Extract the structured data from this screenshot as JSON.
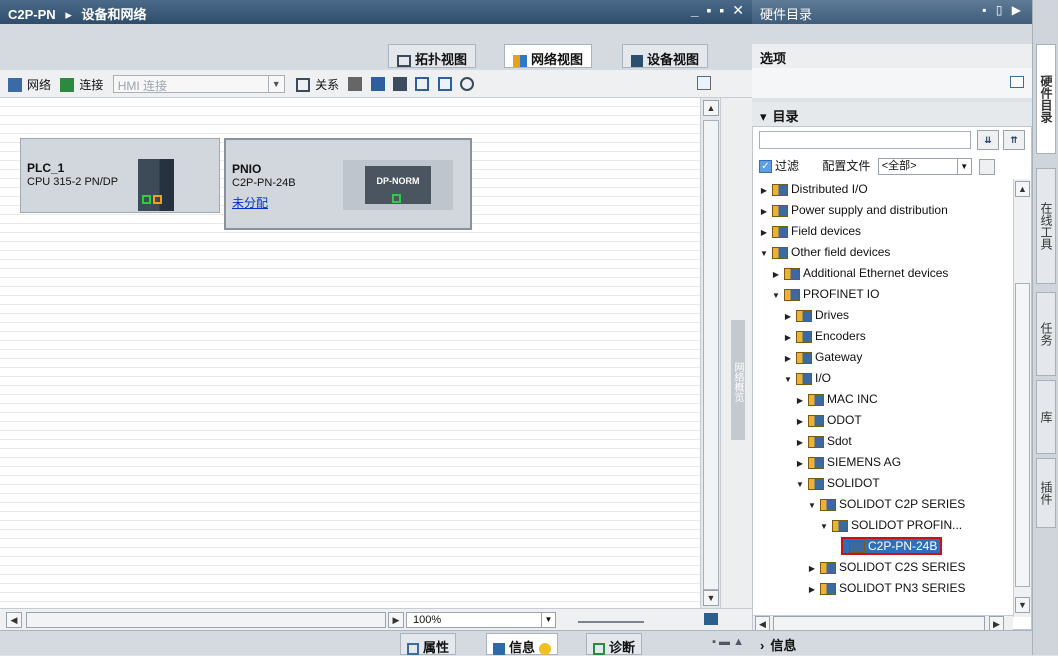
{
  "left_window": {
    "breadcrumb_root": "C2P-PN",
    "breadcrumb_sep": "▸",
    "breadcrumb_page": "设备和网络",
    "controls": "_ ▪ ▪ ✕"
  },
  "view_tabs": [
    {
      "label": "拓扑视图",
      "icon": "topology-icon"
    },
    {
      "label": "网络视图",
      "icon": "network-icon",
      "active": true
    },
    {
      "label": "设备视图",
      "icon": "device-icon"
    }
  ],
  "toolbar": {
    "network_label": "网络",
    "connect_label": "连接",
    "hmi_placeholder": "HMI 连接",
    "relation_label": "关系"
  },
  "devices": [
    {
      "name": "PLC_1",
      "type": "CPU 315-2 PN/DP"
    },
    {
      "name": "PNIO",
      "type": "C2P-PN-24B",
      "link": "未分配",
      "module": "DP-NORM"
    }
  ],
  "side_strip_label": "网络概览",
  "status": {
    "zoom": "100%"
  },
  "bottom_tabs": {
    "properties": "属性",
    "info": "信息",
    "diagnostics": "诊断"
  },
  "catalog_window": {
    "title": "硬件目录",
    "options_label": "选项",
    "catalog_label": "目录",
    "filter_label": "过滤",
    "profile_label": "配置文件",
    "profile_value": "<全部>",
    "info_label": "信息"
  },
  "tree": [
    {
      "label": "Distributed I/O",
      "level": 0,
      "expanded": false
    },
    {
      "label": "Power supply and distribution",
      "level": 0,
      "expanded": false
    },
    {
      "label": "Field devices",
      "level": 0,
      "expanded": false
    },
    {
      "label": "Other field devices",
      "level": 0,
      "expanded": true
    },
    {
      "label": "Additional Ethernet devices",
      "level": 1,
      "expanded": false
    },
    {
      "label": "PROFINET IO",
      "level": 1,
      "expanded": true
    },
    {
      "label": "Drives",
      "level": 2,
      "expanded": false
    },
    {
      "label": "Encoders",
      "level": 2,
      "expanded": false
    },
    {
      "label": "Gateway",
      "level": 2,
      "expanded": false
    },
    {
      "label": "I/O",
      "level": 2,
      "expanded": true
    },
    {
      "label": "MAC INC",
      "level": 3,
      "expanded": false
    },
    {
      "label": "ODOT",
      "level": 3,
      "expanded": false
    },
    {
      "label": "Sdot",
      "level": 3,
      "expanded": false
    },
    {
      "label": "SIEMENS AG",
      "level": 3,
      "expanded": false
    },
    {
      "label": "SOLIDOT",
      "level": 3,
      "expanded": true
    },
    {
      "label": "SOLIDOT C2P SERIES",
      "level": 4,
      "expanded": true
    },
    {
      "label": "SOLIDOT PROFIN...",
      "level": 5,
      "expanded": true
    },
    {
      "label": "C2P-PN-24B",
      "level": 6,
      "selected": true
    },
    {
      "label": "SOLIDOT C2S SERIES",
      "level": 4,
      "expanded": false
    },
    {
      "label": "SOLIDOT PN3 SERIES",
      "level": 4,
      "expanded": false
    }
  ],
  "vertical_tabs": [
    "硬件目录",
    "在线工具",
    "任务",
    "库",
    "插件"
  ]
}
